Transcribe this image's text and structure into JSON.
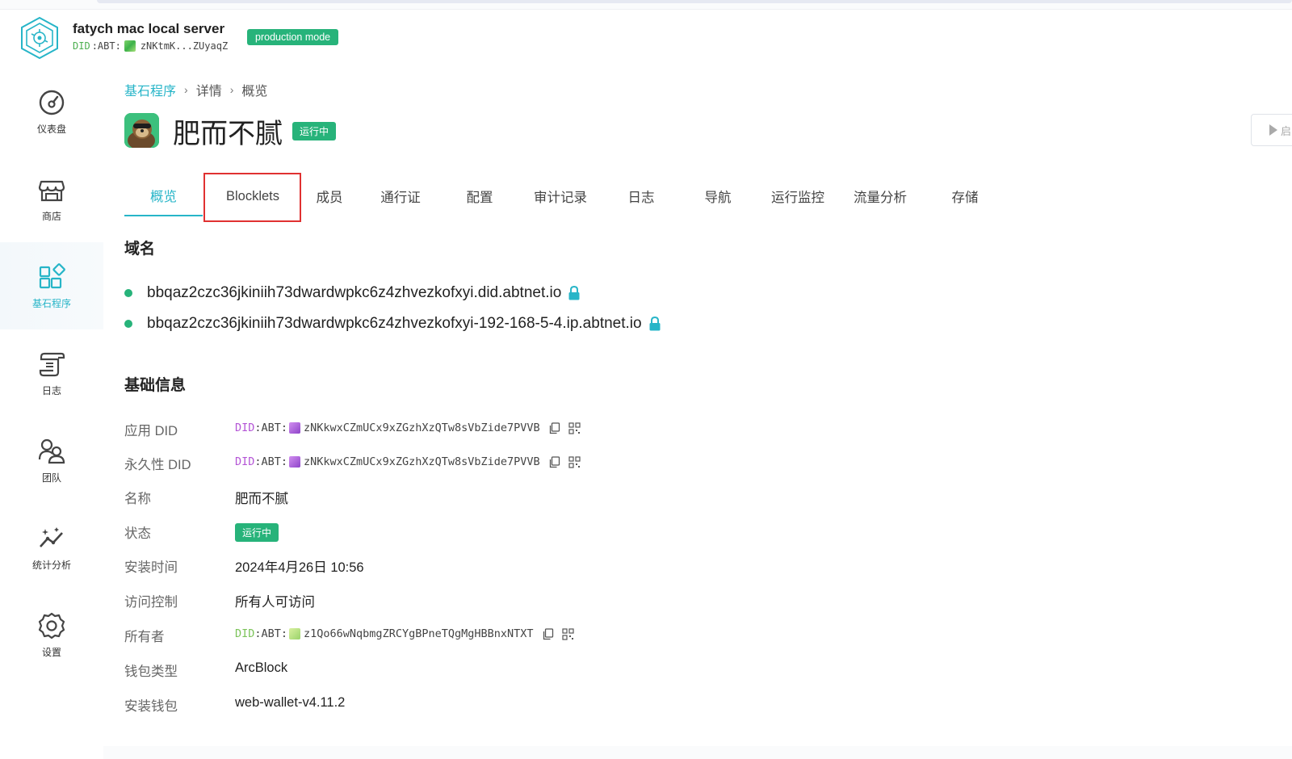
{
  "header": {
    "server_name": "fatych mac local server",
    "did_prefix": "DID",
    "did_abt": ":ABT:",
    "did_short": "zNKtmK...ZUyaqZ",
    "mode_badge": "production mode"
  },
  "sidebar": {
    "items": [
      {
        "label": "仪表盘",
        "icon": "dashboard-icon"
      },
      {
        "label": "商店",
        "icon": "store-icon"
      },
      {
        "label": "基石程序",
        "icon": "blocklet-icon",
        "active": true
      },
      {
        "label": "日志",
        "icon": "log-icon"
      },
      {
        "label": "团队",
        "icon": "team-icon"
      },
      {
        "label": "统计分析",
        "icon": "analytics-icon"
      },
      {
        "label": "设置",
        "icon": "settings-icon"
      }
    ]
  },
  "breadcrumb": {
    "items": [
      "基石程序",
      "详情",
      "概览"
    ],
    "separator": "›"
  },
  "app": {
    "title": "肥而不腻",
    "status": "运行中",
    "start_label": "启"
  },
  "tabs": [
    {
      "label": "概览",
      "active": true
    },
    {
      "label": "Blocklets"
    },
    {
      "label": "成员"
    },
    {
      "label": "通行证"
    },
    {
      "label": "配置"
    },
    {
      "label": "审计记录"
    },
    {
      "label": "日志"
    },
    {
      "label": "导航"
    },
    {
      "label": "运行监控"
    },
    {
      "label": "流量分析"
    },
    {
      "label": "存储"
    }
  ],
  "domains": {
    "title": "域名",
    "items": [
      "bbqaz2czc36jkiniih73dwardwpkc6z4zhvezkofxyi.did.abtnet.io",
      "bbqaz2czc36jkiniih73dwardwpkc6z4zhvezkofxyi-192-168-5-4.ip.abtnet.io"
    ]
  },
  "basic_info": {
    "title": "基础信息",
    "app_did_label": "应用 DID",
    "app_did_prefix": "DID",
    "app_did_abt": ":ABT:",
    "app_did_value": "zNKkwxCZmUCx9xZGzhXzQTw8sVbZide7PVVB",
    "perm_did_label": "永久性 DID",
    "perm_did_prefix": "DID",
    "perm_did_abt": ":ABT:",
    "perm_did_value": "zNKkwxCZmUCx9xZGzhXzQTw8sVbZide7PVVB",
    "name_label": "名称",
    "name_value": "肥而不腻",
    "status_label": "状态",
    "status_value": "运行中",
    "install_time_label": "安装时间",
    "install_time_value": "2024年4月26日 10:56",
    "access_label": "访问控制",
    "access_value": "所有人可访问",
    "owner_label": "所有者",
    "owner_did_prefix": "DID",
    "owner_did_abt": ":ABT:",
    "owner_did_value": "z1Qo66wNqbmgZRCYgBPneTQgMgHBBnxNTXT",
    "wallet_type_label": "钱包类型",
    "wallet_type_value": "ArcBlock",
    "install_wallet_label": "安装钱包",
    "install_wallet_value": "web-wallet-v4.11.2"
  },
  "colors": {
    "accent": "#27b5c8",
    "success": "#27b37a",
    "highlight": "#e03131"
  }
}
